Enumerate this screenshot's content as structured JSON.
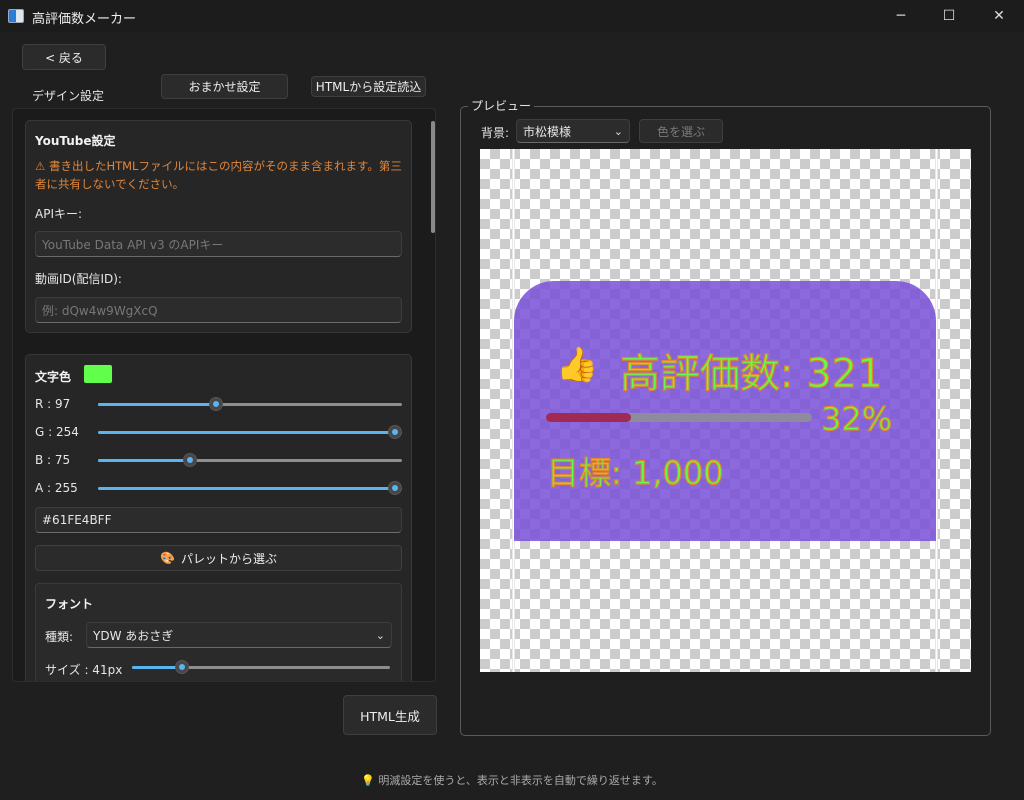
{
  "window": {
    "title": "高評価数メーカー",
    "minimize_icon": "─",
    "maximize_icon": "☐",
    "close_icon": "✕"
  },
  "nav": {
    "back_label": "< 戻る"
  },
  "tabs": {
    "design": "デザイン設定",
    "auto": "おまかせ設定",
    "import": "HTMLから設定読込"
  },
  "youtube": {
    "heading": "YouTube設定",
    "warning": "⚠ 書き出したHTMLファイルにはこの内容がそのまま含まれます。第三者に共有しないでください。",
    "api_key_label": "APIキー:",
    "api_key_placeholder": "YouTube Data API v3 のAPIキー",
    "video_id_label": "動画ID(配信ID):",
    "video_id_placeholder": "例: dQw4w9WgXcQ"
  },
  "text_color": {
    "heading": "文字色",
    "swatch": "#61FE4B",
    "r_label": "R : 97",
    "r": 97,
    "g_label": "G : 254",
    "g": 254,
    "b_label": "B : 75",
    "b": 75,
    "a_label": "A : 255",
    "a": 255,
    "hex_value": "#61FE4BFF",
    "palette_button": "パレットから選ぶ",
    "palette_icon": "🎨"
  },
  "font": {
    "heading": "フォント",
    "type_label": "種類:",
    "type_value": "YDW あおさぎ",
    "size_label": "サイズ : 41px",
    "size_fraction": 0.19
  },
  "generate_button": "HTML生成",
  "preview": {
    "legend": "プレビュー",
    "bg_label": "背景:",
    "bg_value": "市松模様",
    "pick_color_button": "色を選ぶ",
    "thumb_emoji": "👍",
    "count_text": "高評価数: 321",
    "progress_percent": 32,
    "percent_text": "32%",
    "goal_text": "目標: 1,000",
    "bar_fill_color": "#a12a55",
    "bar_track_color": "#8c8c9c",
    "widget_bg": "#7850d7"
  },
  "footer_tip": "💡 明滅設定を使うと、表示と非表示を自動で繰り返せます。",
  "colors": {
    "accent": "#59b4f0",
    "warning": "#e0863a",
    "text_stroke": "#e0862c"
  }
}
